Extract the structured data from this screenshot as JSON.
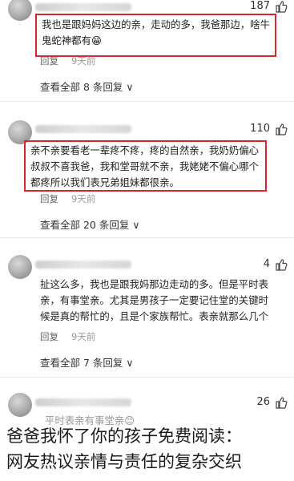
{
  "comments": [
    {
      "likes": "187",
      "content": "我也是跟妈妈这边的亲，走动的多，我爸那边，啥牛鬼蛇神都有😁",
      "reply_label": "回复",
      "time": "9天前",
      "view_all": "查看全部 8 条回复 ∨"
    },
    {
      "likes": "110",
      "content": "亲不亲要看老一辈疼不疼，疼的自然亲，我奶奶偏心叔叔不喜我爸，我和堂哥就不亲，我姥姥不偏心哪个都疼所以我们表兄弟姐妹都很亲。",
      "reply_label": "回复",
      "time": "9天前",
      "view_all": "查看全部 20 条回复 ∨"
    },
    {
      "likes": "4",
      "content": "扯这么多，我也是跟我妈那边走动的多。但是平时表亲，有事堂亲。尤其是男孩子一定要记住堂的关键时候是真的帮忙的，且是个家族帮忙。表亲就那么几个",
      "reply_label": "回复",
      "time": "9天前",
      "view_all": "查看全部 7 条回复 ∨"
    },
    {
      "likes": "26",
      "content": "平时表亲有事堂亲😊"
    }
  ],
  "caption": {
    "line1": "爸爸我怀了你的孩子免费阅读：",
    "line2": "网友热议亲情与责任的复杂交织"
  },
  "colors": {
    "highlight": "#d8262c",
    "meta": "#9a9a9a"
  },
  "icons": [
    "thumb-up-icon"
  ]
}
